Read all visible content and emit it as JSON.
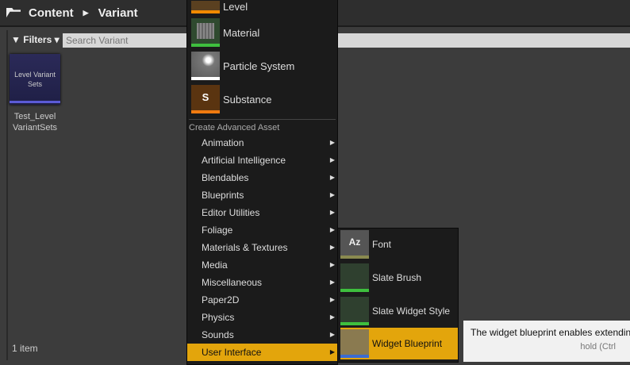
{
  "breadcrumb": {
    "root": "Content",
    "current": "Variant"
  },
  "toolbar": {
    "filters_label": "Filters",
    "search_placeholder": "Search Variant"
  },
  "asset": {
    "thumb_label": "Level Variant Sets",
    "name": "Test_Level VariantSets"
  },
  "status": {
    "count": "1 item"
  },
  "menu": {
    "basic": [
      {
        "label": "Level",
        "color": "#f08a00"
      },
      {
        "label": "Material",
        "color": "#3ebf3e"
      },
      {
        "label": "Particle System",
        "color": "#ffffff"
      },
      {
        "label": "Substance",
        "color": "#f07a10"
      }
    ],
    "section": "Create Advanced Asset",
    "items": [
      "Animation",
      "Artificial Intelligence",
      "Blendables",
      "Blueprints",
      "Editor Utilities",
      "Foliage",
      "Materials & Textures",
      "Media",
      "Miscellaneous",
      "Paper2D",
      "Physics",
      "Sounds",
      "User Interface"
    ]
  },
  "submenu": {
    "items": [
      {
        "label": "Font",
        "color": "#8a8a50"
      },
      {
        "label": "Slate Brush",
        "color": "#3ebf3e"
      },
      {
        "label": "Slate Widget Style",
        "color": "#3ebf3e"
      },
      {
        "label": "Widget Blueprint",
        "color": "#3c6cd0"
      }
    ]
  },
  "tooltip": {
    "text": "The widget blueprint enables extending",
    "hint": "hold (Ctrl"
  }
}
